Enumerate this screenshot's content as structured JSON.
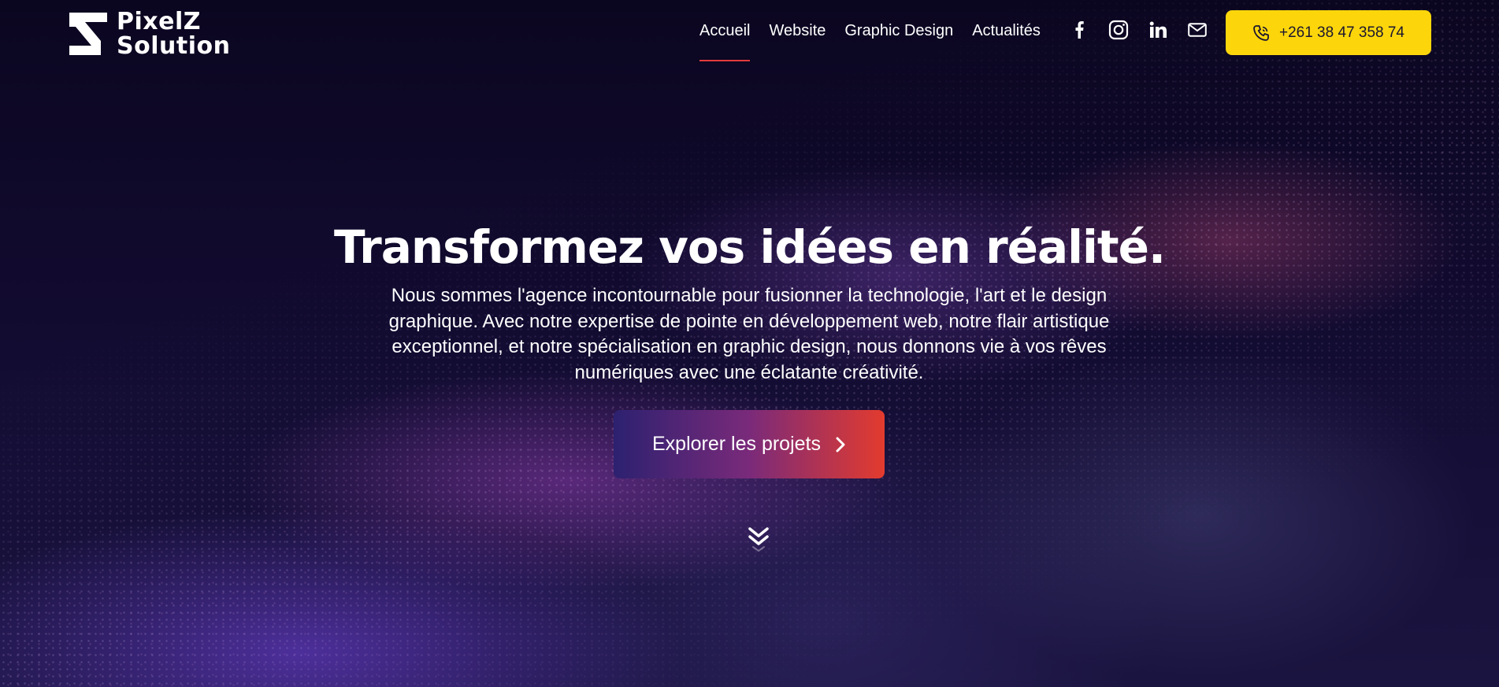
{
  "brand": {
    "line1": "PixelZ",
    "line2": "Solution"
  },
  "nav": {
    "items": [
      {
        "label": "Accueil"
      },
      {
        "label": "Website"
      },
      {
        "label": "Graphic Design"
      },
      {
        "label": "Actualités"
      }
    ]
  },
  "socials": [
    "facebook-icon",
    "instagram-icon",
    "linkedin-icon",
    "mail-icon"
  ],
  "phone": {
    "label": "+261 38 47 358 74"
  },
  "hero": {
    "title": "Transformez vos idées en réalité.",
    "description": "Nous sommes l'agence incontournable pour fusionner la technologie, l'art et le design graphique. Avec notre expertise de pointe en développement web, notre flair artistique exceptionnel, et notre spécialisation en graphic design, nous donnons vie à vos rêves numériques avec une éclatante créativité.",
    "cta_label": "Explorer les projets"
  },
  "colors": {
    "accent_yellow": "#fcd60b",
    "active_underline": "#e23b3b",
    "cta_gradient_start": "#2c2170",
    "cta_gradient_end": "#e33b2e"
  }
}
